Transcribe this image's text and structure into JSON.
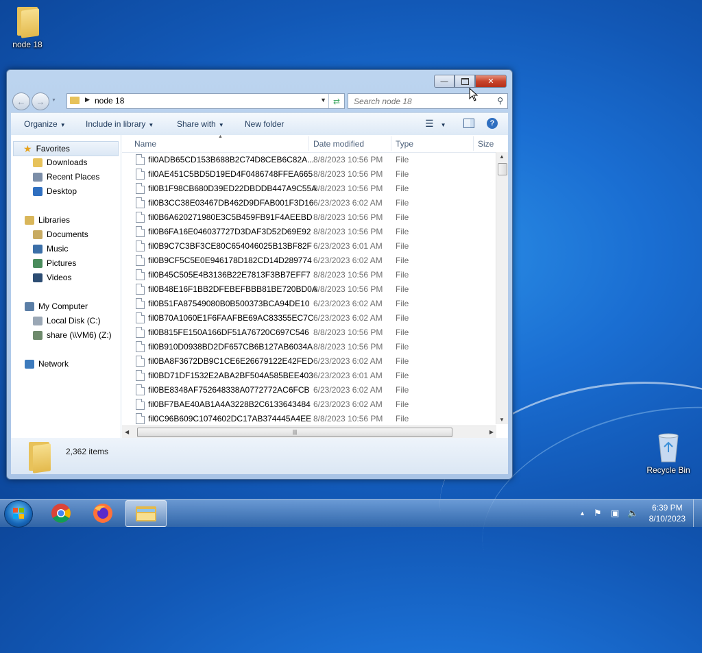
{
  "desktop": {
    "folder_icon_label": "node 18",
    "recycle_bin_label": "Recycle Bin"
  },
  "window": {
    "controls": {
      "minimize": "▭",
      "maximize": "▢",
      "close": "✕"
    },
    "address": {
      "path": "node 18"
    },
    "search": {
      "placeholder": "Search node 18"
    },
    "toolbar": {
      "organize": "Organize",
      "include_in_library": "Include in library",
      "share_with": "Share with",
      "new_folder": "New folder",
      "help": "?"
    },
    "nav": {
      "favorites": "Favorites",
      "downloads": "Downloads",
      "recent_places": "Recent Places",
      "desktop": "Desktop",
      "libraries": "Libraries",
      "documents": "Documents",
      "music": "Music",
      "pictures": "Pictures",
      "videos": "Videos",
      "my_computer": "My Computer",
      "local_disk": "Local Disk (C:)",
      "share": "share (\\\\VM6) (Z:)",
      "network": "Network"
    },
    "columns": {
      "name": "Name",
      "date": "Date modified",
      "type": "Type",
      "size": "Size"
    },
    "files": [
      {
        "name": "fil0ADB65CD153B688B2C74D8CEB6C82A...",
        "date": "8/8/2023 10:56 PM",
        "type": "File"
      },
      {
        "name": "fil0AE451C5BD5D19ED4F0486748FFEA665",
        "date": "8/8/2023 10:56 PM",
        "type": "File"
      },
      {
        "name": "fil0B1F98CB680D39ED22DBDDB447A9C55A",
        "date": "8/8/2023 10:56 PM",
        "type": "File"
      },
      {
        "name": "fil0B3CC38E03467DB462D9DFAB001F3D16",
        "date": "6/23/2023 6:02 AM",
        "type": "File"
      },
      {
        "name": "fil0B6A620271980E3C5B459FB91F4AEEBD",
        "date": "8/8/2023 10:56 PM",
        "type": "File"
      },
      {
        "name": "fil0B6FA16E046037727D3DAF3D52D69E92",
        "date": "8/8/2023 10:56 PM",
        "type": "File"
      },
      {
        "name": "fil0B9C7C3BF3CE80C654046025B13BF82F",
        "date": "6/23/2023 6:01 AM",
        "type": "File"
      },
      {
        "name": "fil0B9CF5C5E0E946178D182CD14D289774",
        "date": "6/23/2023 6:02 AM",
        "type": "File"
      },
      {
        "name": "fil0B45C505E4B3136B22E7813F3BB7EFF7",
        "date": "8/8/2023 10:56 PM",
        "type": "File"
      },
      {
        "name": "fil0B48E16F1BB2DFEBEFBBB81BE720BD0A",
        "date": "8/8/2023 10:56 PM",
        "type": "File"
      },
      {
        "name": "fil0B51FA87549080B0B500373BCA94DE10",
        "date": "6/23/2023 6:02 AM",
        "type": "File"
      },
      {
        "name": "fil0B70A1060E1F6FAAFBE69AC83355EC7C",
        "date": "6/23/2023 6:02 AM",
        "type": "File"
      },
      {
        "name": "fil0B815FE150A166DF51A76720C697C546",
        "date": "8/8/2023 10:56 PM",
        "type": "File"
      },
      {
        "name": "fil0B910D0938BD2DF657CB6B127AB6034A",
        "date": "8/8/2023 10:56 PM",
        "type": "File"
      },
      {
        "name": "fil0BA8F3672DB9C1CE6E26679122E42FED",
        "date": "6/23/2023 6:02 AM",
        "type": "File"
      },
      {
        "name": "fil0BD71DF1532E2ABA2BF504A585BEE403",
        "date": "6/23/2023 6:01 AM",
        "type": "File"
      },
      {
        "name": "fil0BE8348AF752648338A0772772AC6FCB",
        "date": "6/23/2023 6:02 AM",
        "type": "File"
      },
      {
        "name": "fil0BF7BAE40AB1A4A3228B2C6133643484",
        "date": "6/23/2023 6:02 AM",
        "type": "File"
      },
      {
        "name": "fil0C96B609C1074602DC17AB374445A4EE",
        "date": "8/8/2023 10:56 PM",
        "type": "File"
      }
    ],
    "status": {
      "item_count": "2,362 items"
    }
  },
  "taskbar": {
    "time": "6:39 PM",
    "date": "8/10/2023",
    "tray_up": "▲"
  }
}
